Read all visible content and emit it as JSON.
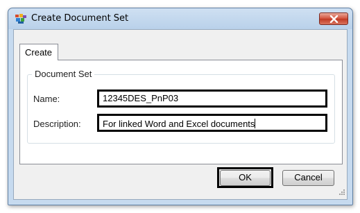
{
  "window": {
    "title": "Create Document Set",
    "app_icon": "document-set-icon",
    "close_icon": "close-icon",
    "title_color": "#000000",
    "close_color": "#c8452d"
  },
  "tabs": [
    {
      "label": "Create",
      "selected": true
    }
  ],
  "group": {
    "label": "Document Set"
  },
  "form": {
    "name_label": "Name:",
    "name_value": "12345DES_PnP03",
    "description_label": "Description:",
    "description_value": "For linked Word and Excel documents"
  },
  "buttons": {
    "ok_label": "OK",
    "cancel_label": "Cancel"
  },
  "resize_icon": "resize-grip-icon"
}
